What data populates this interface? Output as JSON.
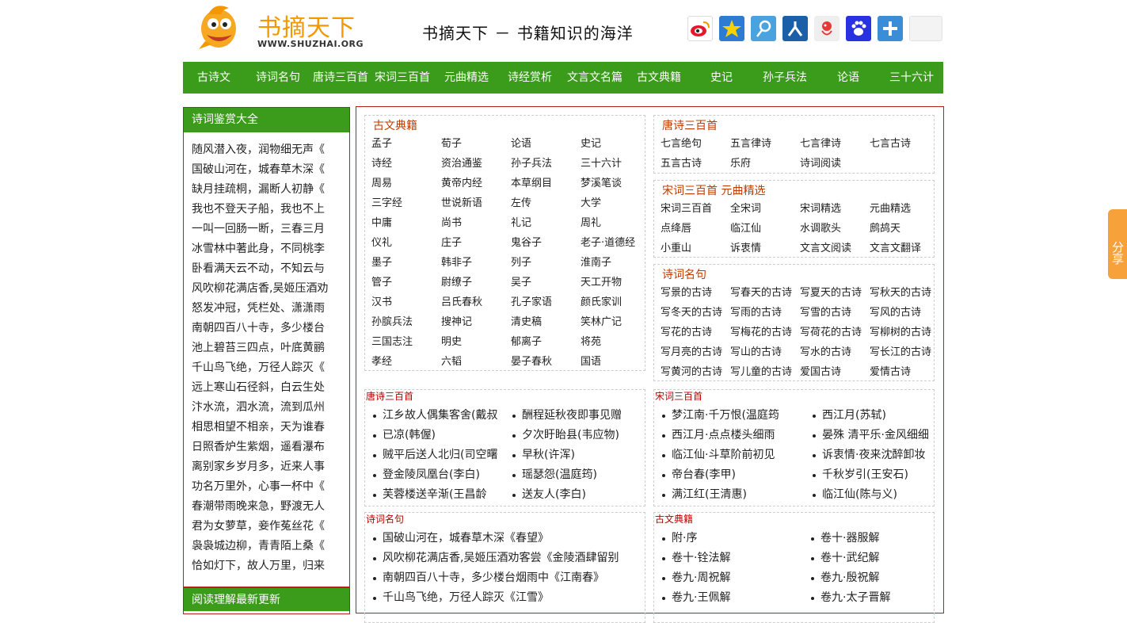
{
  "logo": {
    "name": "书摘天下",
    "url": "WWW.SHUZHAI.ORG"
  },
  "site_title": "书摘天下 － 书籍知识的海洋",
  "share_icons": [
    "weibo-icon",
    "qzone-icon",
    "tencent-weibo-icon",
    "renren-icon",
    "pengyou-icon",
    "baidu-icon",
    "more-share-icon",
    "blank-icon"
  ],
  "nav": [
    "古诗文",
    "诗词名句",
    "唐诗三百首",
    "宋词三百首",
    "元曲精选",
    "诗经赏析",
    "文言文名篇",
    "古文典籍",
    "史记",
    "孙子兵法",
    "论语",
    "三十六计"
  ],
  "sidebar": {
    "title": "诗词鉴赏大全",
    "items": [
      "随风潜入夜，润物细无声《",
      "国破山河在，城春草木深《",
      "缺月挂疏桐，漏断人初静《",
      "我也不登天子船，我也不上",
      "一叫一回肠一断，三春三月",
      "冰雪林中著此身，不同桃李",
      "卧看满天云不动，不知云与",
      "风吹柳花满店香,吴姬压酒劝",
      "怒发冲冠，凭栏处、潇潇雨",
      "南朝四百八十寺，多少楼台",
      "池上碧苔三四点，叶底黄鹂",
      "千山鸟飞绝，万径人踪灭《",
      "远上寒山石径斜，白云生处",
      "汴水流，泗水流，流到瓜州",
      "相思相望不相亲，天为谁春",
      "日照香炉生紫烟，遥看瀑布",
      "离别家乡岁月多，近来人事",
      "功名万里外，心事一杯中《",
      "春潮带雨晚来急，野渡无人",
      "君为女萝草，妾作菟丝花《",
      "袅袅城边柳，青青陌上桑《",
      "恰如灯下，故人万里，归来"
    ],
    "title2": "阅读理解最新更新"
  },
  "classics": {
    "title": "古文典籍",
    "items": [
      "孟子",
      "荀子",
      "论语",
      "史记",
      "诗经",
      "资治通鉴",
      "孙子兵法",
      "三十六计",
      "周易",
      "黄帝内经",
      "本草纲目",
      "梦溪笔谈",
      "三字经",
      "世说新语",
      "左传",
      "大学",
      "中庸",
      "尚书",
      "礼记",
      "周礼",
      "仪礼",
      "庄子",
      "鬼谷子",
      "老子·道德经",
      "墨子",
      "韩非子",
      "列子",
      "淮南子",
      "管子",
      "尉缭子",
      "吴子",
      "天工开物",
      "汉书",
      "吕氏春秋",
      "孔子家语",
      "颜氏家训",
      "孙膑兵法",
      "搜神记",
      "清史稿",
      "笑林广记",
      "三国志注",
      "明史",
      "郁离子",
      "将苑",
      "孝经",
      "六韬",
      "晏子春秋",
      "国语"
    ]
  },
  "tang": {
    "title": "唐诗三百首",
    "items": [
      "七言绝句",
      "五言律诗",
      "七言律诗",
      "七言古诗",
      "五言古诗",
      "乐府",
      "诗词阅读"
    ]
  },
  "song": {
    "title": "宋词三百首 元曲精选",
    "items": [
      "宋词三百首",
      "全宋词",
      "宋词精选",
      "元曲精选",
      "点绛唇",
      "临江仙",
      "水调歌头",
      "鹧鸪天",
      "小重山",
      "诉衷情",
      "文言文阅读",
      "文言文翻译"
    ]
  },
  "famous": {
    "title": "诗词名句",
    "items": [
      "写景的古诗",
      "写春天的古诗",
      "写夏天的古诗",
      "写秋天的古诗",
      "写冬天的古诗",
      "写雨的古诗",
      "写雪的古诗",
      "写风的古诗",
      "写花的古诗",
      "写梅花的古诗",
      "写荷花的古诗",
      "写柳树的古诗",
      "写月亮的古诗",
      "写山的古诗",
      "写水的古诗",
      "写长江的古诗",
      "写黄河的古诗",
      "写儿童的古诗",
      "爱国古诗",
      "爱情古诗"
    ]
  },
  "tang_list": {
    "title": "唐诗三百首",
    "items": [
      "江乡故人偶集客舍(戴叔",
      "酬程延秋夜即事见赠",
      "已凉(韩偓)",
      "夕次盱眙县(韦应物)",
      "贼平后送人北归(司空曙",
      "早秋(许浑)",
      "登金陵凤凰台(李白)",
      "瑶瑟怨(温庭筠)",
      "芙蓉楼送辛渐(王昌龄",
      "送友人(李白)"
    ]
  },
  "song_list": {
    "title": "宋词三百首",
    "items": [
      "梦江南·千万恨(温庭筠",
      "西江月(苏轼)",
      "西江月·点点楼头细雨",
      "晏殊 清平乐·金风细细",
      "临江仙·斗草阶前初见",
      "诉衷情·夜来沈醉卸妆",
      "帝台春(李甲)",
      "千秋岁引(王安石)",
      "满江红(王清惠)",
      "临江仙(陈与义)"
    ]
  },
  "quote_list": {
    "title": "诗词名句",
    "items": [
      "国破山河在，城春草木深《春望》",
      "风吹柳花满店香,吴姬压酒劝客尝《金陵酒肆留别",
      "南朝四百八十寺，多少楼台烟雨中《江南春》",
      "千山鸟飞绝，万径人踪灭《江雪》"
    ]
  },
  "classic_list": {
    "title": "古文典籍",
    "items": [
      "附·序",
      "卷十·器服解",
      "卷十·铨法解",
      "卷十·武纪解",
      "卷九·周祝解",
      "卷九·殷祝解",
      "卷九·王佩解",
      "卷九·太子晋解"
    ]
  },
  "side_tab": "分享",
  "colors": {
    "green": "#3b9b1b",
    "red_border": "#b52121",
    "orange": "#f39800",
    "title_red": "#c33a00"
  }
}
